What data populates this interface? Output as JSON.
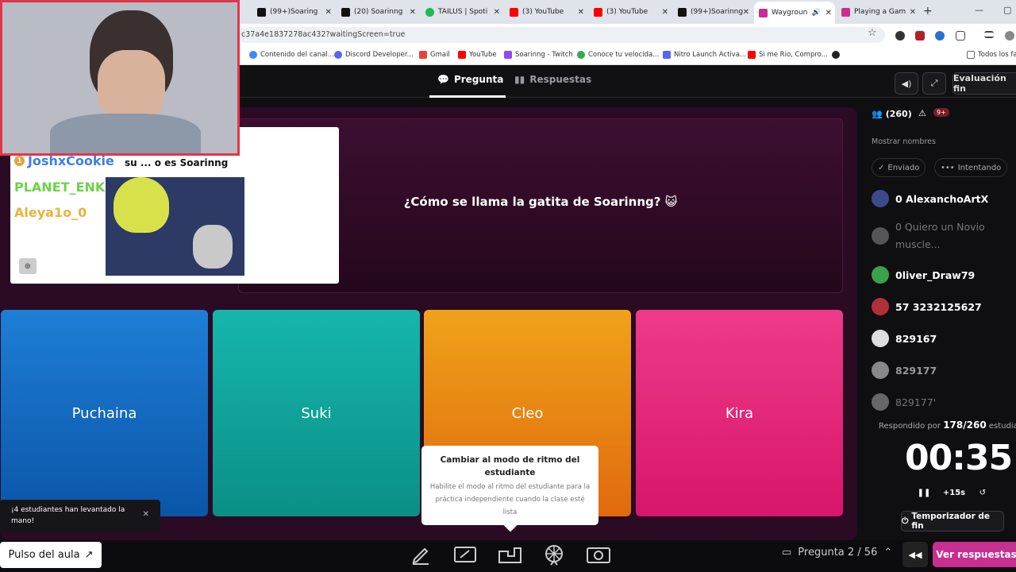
{
  "browser": {
    "tabs": [
      {
        "label": "(99+)Soaring",
        "color": "#111111"
      },
      {
        "label": "(20) Soarinng",
        "color": "#111111"
      },
      {
        "label": "TAILUS | Spoti",
        "color": "#1db954"
      },
      {
        "label": "(3) YouTube",
        "color": "#ff0000"
      },
      {
        "label": "(3) YouTube",
        "color": "#ff0000"
      },
      {
        "label": "(99+)Soarinng",
        "color": "#111111"
      },
      {
        "label": "Waygroun",
        "color": "#c72f91"
      },
      {
        "label": "Playing a Gam",
        "color": "#c72f91"
      }
    ],
    "url": "c37a4e1837278ac432?waitingScreen=true",
    "bookmarks": [
      {
        "label": "Contenido del canal...",
        "color": "#4285f4"
      },
      {
        "label": "Discord Developer...",
        "color": "#5865f2"
      },
      {
        "label": "Gmail",
        "color": "#ea4335"
      },
      {
        "label": "YouTube",
        "color": "#ff0000"
      },
      {
        "label": "Soarinng - Twitch",
        "color": "#9146ff"
      },
      {
        "label": "Conoce tu velocida...",
        "color": "#34a853"
      },
      {
        "label": "Nitro Launch Activa...",
        "color": "#5865f2"
      },
      {
        "label": "Si me Rio, Compro...",
        "color": "#ff0000"
      }
    ],
    "bookmarks_right": "Todos los fav"
  },
  "header": {
    "tab_question": "Pregunta",
    "tab_answers": "Respuestas",
    "end_eval": "Evaluación fin"
  },
  "question": {
    "text": "¿Cómo se llama la gatita de Soarinng? 😺"
  },
  "answers": [
    {
      "label": "Puchaina",
      "color_top": "#1e7ed6",
      "color_bottom": "#0a56a8"
    },
    {
      "label": "Suki",
      "color_top": "#16b6ad",
      "color_bottom": "#0a8f86"
    },
    {
      "label": "Cleo",
      "color_top": "#f0a21a",
      "color_bottom": "#e06a0e"
    },
    {
      "label": "Kira",
      "color_top": "#ef3a8a",
      "color_bottom": "#d8156a"
    }
  ],
  "tooltip": {
    "title": "Cambiar al modo de ritmo del estudiante",
    "body": "Habilite el modo al ritmo del estudiante para la práctica independiente cuando la clase esté lista"
  },
  "hand_raise": {
    "text": "¡4 estudiantes han levantado la mano!"
  },
  "sidebar": {
    "count": "(260)",
    "alerts": "9+",
    "show_names": "Mostrar nombres",
    "filters": [
      "Enviado",
      "Intentando"
    ],
    "students": [
      {
        "name": "0 AlexanchoArtX",
        "color": "#3b4a8a",
        "dim": false
      },
      {
        "name": "0 Quiero un Novio muscle...",
        "color": "#555555",
        "dim": true
      },
      {
        "name": "0liver_Draw79",
        "color": "#3aa34a",
        "dim": false
      },
      {
        "name": "57 3232125627",
        "color": "#b0303a",
        "dim": false
      },
      {
        "name": "829167",
        "color": "#dddddd",
        "dim": false
      },
      {
        "name": "829177",
        "color": "#888888",
        "dim": true
      },
      {
        "name": "829177'",
        "color": "#666666",
        "dim": true
      }
    ],
    "answered_prefix": "Respondido por",
    "answered_value": "178/260",
    "answered_suffix": "estudiant",
    "timer": "00:35",
    "add_time": "+15s",
    "end_timer": "Temporizador de fin"
  },
  "bottombar": {
    "pulse": "Pulso del aula",
    "question_nav": "Pregunta 2 / 56",
    "see_answers": "Ver respuestas"
  },
  "overlay": {
    "chat": [
      {
        "user": "JoshxCookie",
        "color": "#3f7fe0",
        "badge": "1"
      },
      {
        "user": "PLANET_ENK",
        "color": "#6fd14a",
        "badge": ""
      },
      {
        "user": "Aleya1o_0",
        "color": "#e8b33d",
        "badge": ""
      }
    ],
    "chat_message": "su ... o es Soarinng"
  }
}
